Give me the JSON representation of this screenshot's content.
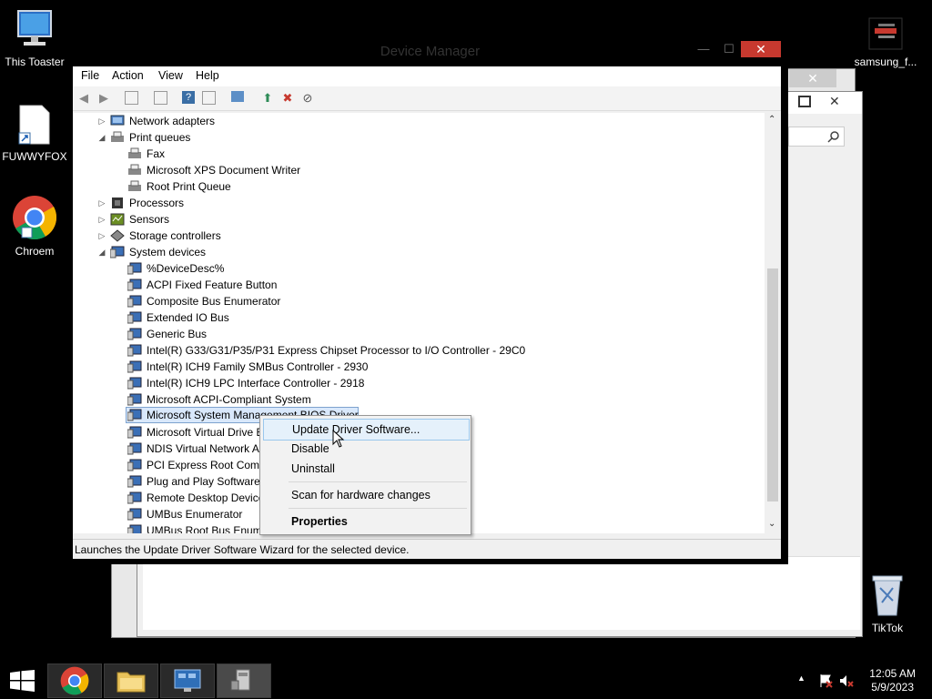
{
  "desktop": {
    "icons": [
      {
        "label": "This Toaster"
      },
      {
        "label": "FUWWYFOX"
      },
      {
        "label": "Chroem"
      },
      {
        "label": "samsung_f..."
      },
      {
        "label": "TikTok"
      }
    ]
  },
  "device_manager": {
    "title": "Device Manager",
    "menu": [
      "File",
      "Action",
      "View",
      "Help"
    ],
    "tree": [
      {
        "label": "Network adapters",
        "level": 1,
        "expanded": false
      },
      {
        "label": "Print queues",
        "level": 1,
        "expanded": true
      },
      {
        "label": "Fax",
        "level": 2
      },
      {
        "label": "Microsoft XPS Document Writer",
        "level": 2
      },
      {
        "label": "Root Print Queue",
        "level": 2
      },
      {
        "label": "Processors",
        "level": 1,
        "expanded": false
      },
      {
        "label": "Sensors",
        "level": 1,
        "expanded": false
      },
      {
        "label": "Storage controllers",
        "level": 1,
        "expanded": false
      },
      {
        "label": "System devices",
        "level": 1,
        "expanded": true
      },
      {
        "label": "%DeviceDesc%",
        "level": 2
      },
      {
        "label": "ACPI Fixed Feature Button",
        "level": 2
      },
      {
        "label": "Composite Bus Enumerator",
        "level": 2
      },
      {
        "label": "Extended IO Bus",
        "level": 2
      },
      {
        "label": "Generic Bus",
        "level": 2
      },
      {
        "label": "Intel(R) G33/G31/P35/P31 Express Chipset Processor to I/O Controller - 29C0",
        "level": 2
      },
      {
        "label": "Intel(R) ICH9 Family SMBus Controller - 2930",
        "level": 2
      },
      {
        "label": "Intel(R) ICH9 LPC Interface Controller - 2918",
        "level": 2
      },
      {
        "label": "Microsoft ACPI-Compliant System",
        "level": 2
      },
      {
        "label": "Microsoft System Management BIOS Driver",
        "level": 2,
        "selected": true
      },
      {
        "label": "Microsoft Virtual Drive Enumerator",
        "level": 2
      },
      {
        "label": "NDIS Virtual Network Adapter Enumerator",
        "level": 2
      },
      {
        "label": "PCI Express Root Complex",
        "level": 2
      },
      {
        "label": "Plug and Play Software Device Enumerator",
        "level": 2
      },
      {
        "label": "Remote Desktop Device Redirector Bus",
        "level": 2
      },
      {
        "label": "UMBus Enumerator",
        "level": 2
      },
      {
        "label": "UMBus Root Bus Enumerator",
        "level": 2
      }
    ],
    "status": "Launches the Update Driver Software Wizard for the selected device."
  },
  "context_menu": {
    "items": [
      {
        "label": "Update Driver Software...",
        "highlighted": true
      },
      {
        "label": "Disable"
      },
      {
        "label": "Uninstall"
      },
      {
        "label": "Scan for hardware changes"
      },
      {
        "label": "Properties",
        "bold": true
      }
    ]
  },
  "taskbar": {
    "clock_time": "12:05 AM",
    "clock_date": "5/9/2023"
  },
  "colors": {
    "close_button": "#c7392f",
    "selection": "#d9e8fb",
    "menu_highlight": "#e5f1fb"
  }
}
